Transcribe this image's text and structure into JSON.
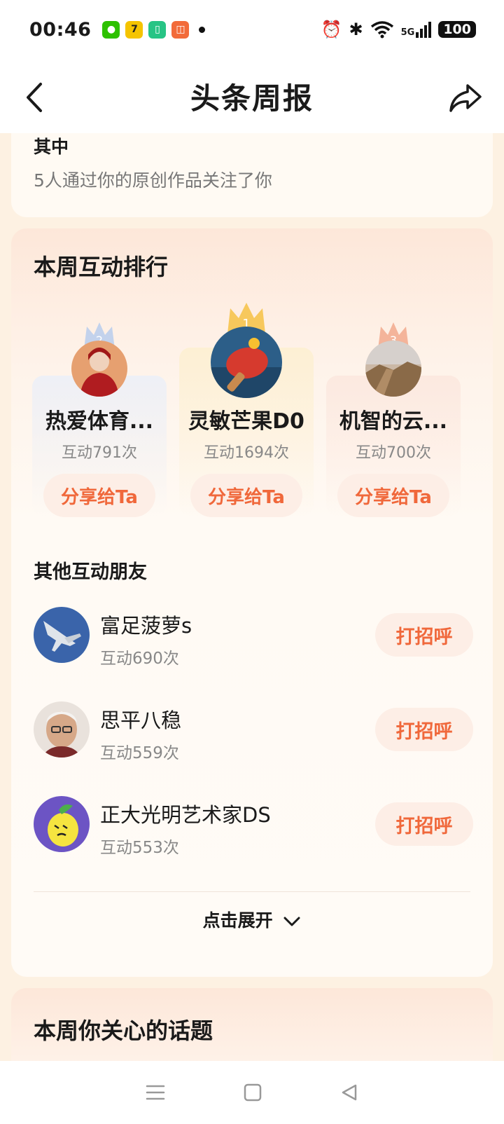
{
  "status_bar": {
    "time": "00:46",
    "signal_label": "5G",
    "battery": "100"
  },
  "header": {
    "title": "头条周报"
  },
  "summary": {
    "label": "其中",
    "text": "5人通过你的原创作品关注了你"
  },
  "ranking": {
    "title": "本周互动排行",
    "top3": [
      {
        "rank": "2",
        "name": "热爱体育...",
        "count": "互动791次",
        "button": "分享给Ta"
      },
      {
        "rank": "1",
        "name": "灵敏芒果D0",
        "count": "互动1694次",
        "button": "分享给Ta"
      },
      {
        "rank": "3",
        "name": "机智的云...",
        "count": "互动700次",
        "button": "分享给Ta"
      }
    ]
  },
  "other_friends": {
    "title": "其他互动朋友",
    "items": [
      {
        "name": "富足菠萝s",
        "count": "互动690次",
        "button": "打招呼"
      },
      {
        "name": "思平八稳",
        "count": "互动559次",
        "button": "打招呼"
      },
      {
        "name": "正大光明艺术家DS",
        "count": "互动553次",
        "button": "打招呼"
      }
    ],
    "expand_label": "点击展开"
  },
  "topics": {
    "title": "本周你关心的话题"
  },
  "colors": {
    "accent": "#f0683b",
    "button_bg": "#fdeee6",
    "page_bg": "#fdf1e2"
  }
}
